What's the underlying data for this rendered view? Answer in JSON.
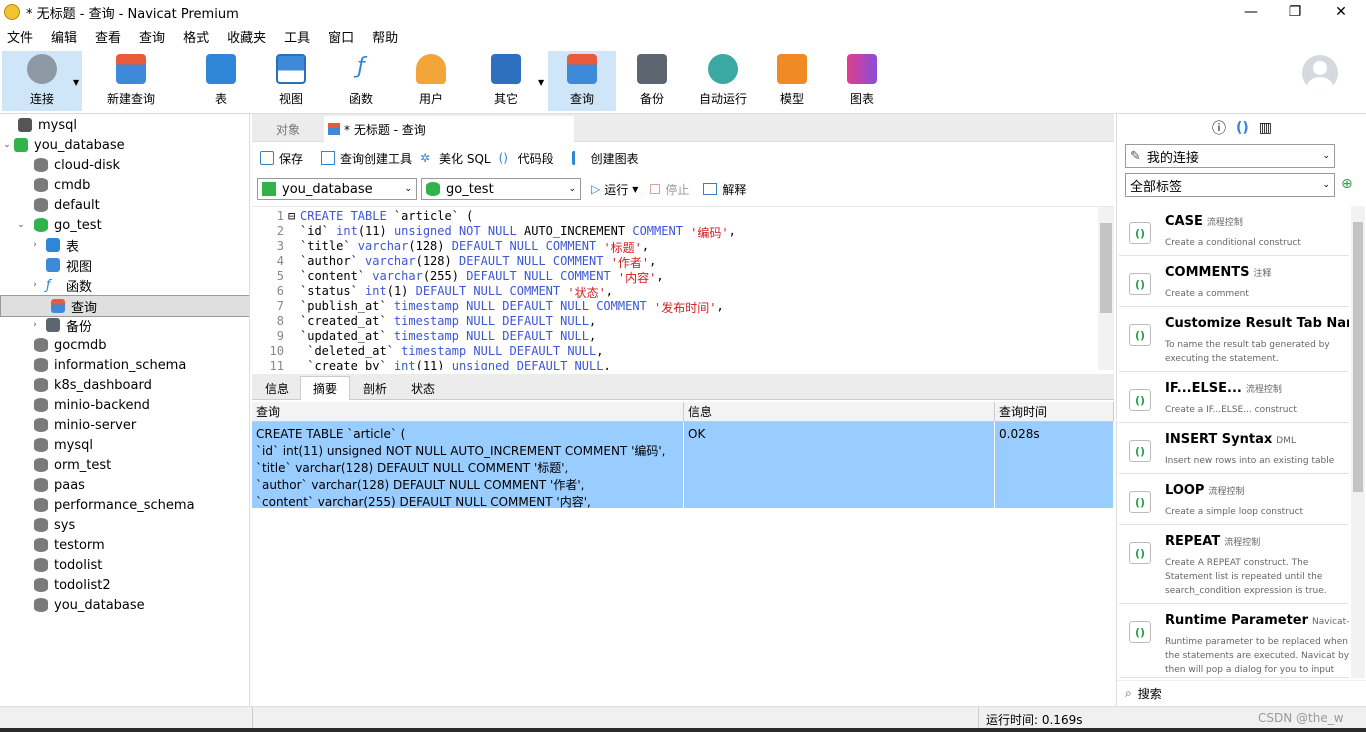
{
  "window": {
    "title": "* 无标题 - 查询 - Navicat Premium",
    "min": "—",
    "max": "❐",
    "close": "✕"
  },
  "menu": [
    "文件",
    "编辑",
    "查看",
    "查询",
    "格式",
    "收藏夹",
    "工具",
    "窗口",
    "帮助"
  ],
  "toolbar": {
    "connect": "连接",
    "new_query": "新建查询",
    "table": "表",
    "view": "视图",
    "function": "函数",
    "user": "用户",
    "other": "其它",
    "query": "查询",
    "backup": "备份",
    "auto_run": "自动运行",
    "model": "模型",
    "chart": "图表"
  },
  "tree": {
    "items": [
      "mysql",
      "you_database",
      "cloud-disk",
      "cmdb",
      "default",
      "go_test",
      "表",
      "视图",
      "函数",
      "查询",
      "备份",
      "gocmdb",
      "information_schema",
      "k8s_dashboard",
      "minio-backend",
      "minio-server",
      "mysql",
      "orm_test",
      "paas",
      "performance_schema",
      "sys",
      "testorm",
      "todolist",
      "todolist2",
      "you_database"
    ]
  },
  "tabs": {
    "objects": "对象",
    "query_tab": "* 无标题 - 查询"
  },
  "query_toolbar": {
    "save": "保存",
    "builder": "查询创建工具",
    "beautify": "美化 SQL",
    "snippet": "代码段",
    "create_chart": "创建图表"
  },
  "selectors": {
    "connection": "you_database",
    "database": "go_test",
    "run": "运行",
    "stop": "停止",
    "explain": "解释"
  },
  "editor": {
    "lines": [
      {
        "n": "1",
        "parts": [
          [
            "kw",
            "CREATE TABLE "
          ],
          [
            "code",
            "`article` ("
          ]
        ]
      },
      {
        "n": "2",
        "parts": [
          [
            "code",
            "`id` "
          ],
          [
            "kw",
            "int"
          ],
          [
            "code",
            "(11) "
          ],
          [
            "kw",
            "unsigned NOT NULL "
          ],
          [
            "code",
            "AUTO_INCREMENT "
          ],
          [
            "kw",
            "COMMENT "
          ],
          [
            "str",
            "'编码'"
          ],
          [
            "code",
            ","
          ]
        ]
      },
      {
        "n": "3",
        "parts": [
          [
            "code",
            "`title` "
          ],
          [
            "kw",
            "varchar"
          ],
          [
            "code",
            "(128) "
          ],
          [
            "kw",
            "DEFAULT NULL COMMENT "
          ],
          [
            "str",
            "'标题'"
          ],
          [
            "code",
            ","
          ]
        ]
      },
      {
        "n": "4",
        "parts": [
          [
            "code",
            "`author` "
          ],
          [
            "kw",
            "varchar"
          ],
          [
            "code",
            "(128) "
          ],
          [
            "kw",
            "DEFAULT NULL COMMENT "
          ],
          [
            "str",
            "'作者'"
          ],
          [
            "code",
            ","
          ]
        ]
      },
      {
        "n": "5",
        "parts": [
          [
            "code",
            "`content` "
          ],
          [
            "kw",
            "varchar"
          ],
          [
            "code",
            "(255) "
          ],
          [
            "kw",
            "DEFAULT NULL COMMENT "
          ],
          [
            "str",
            "'内容'"
          ],
          [
            "code",
            ","
          ]
        ]
      },
      {
        "n": "6",
        "parts": [
          [
            "code",
            "`status` "
          ],
          [
            "kw",
            "int"
          ],
          [
            "code",
            "(1) "
          ],
          [
            "kw",
            "DEFAULT NULL COMMENT "
          ],
          [
            "str",
            "'状态'"
          ],
          [
            "code",
            ","
          ]
        ]
      },
      {
        "n": "7",
        "parts": [
          [
            "code",
            "`publish_at` "
          ],
          [
            "kw",
            "timestamp NULL DEFAULT NULL COMMENT "
          ],
          [
            "str",
            "'发布时间'"
          ],
          [
            "code",
            ","
          ]
        ]
      },
      {
        "n": "8",
        "parts": [
          [
            "code",
            "`created_at` "
          ],
          [
            "kw",
            "timestamp NULL DEFAULT NULL"
          ],
          [
            "code",
            ","
          ]
        ]
      },
      {
        "n": "9",
        "parts": [
          [
            "code",
            "`updated_at` "
          ],
          [
            "kw",
            "timestamp NULL DEFAULT NULL"
          ],
          [
            "code",
            ","
          ]
        ]
      },
      {
        "n": "10",
        "parts": [
          [
            "code",
            " `deleted_at` "
          ],
          [
            "kw",
            "timestamp NULL DEFAULT NULL"
          ],
          [
            "code",
            ","
          ]
        ]
      },
      {
        "n": "11",
        "parts": [
          [
            "code",
            " `create_by` "
          ],
          [
            "kw",
            "int"
          ],
          [
            "code",
            "(11) "
          ],
          [
            "kw",
            "unsigned DEFAULT NULL"
          ],
          [
            "code",
            ","
          ]
        ]
      }
    ]
  },
  "result_tabs": [
    "信息",
    "摘要",
    "剖析",
    "状态"
  ],
  "result": {
    "headers": {
      "query": "查询",
      "info": "信息",
      "time": "查询时间"
    },
    "row": {
      "query": "CREATE TABLE `article` (\n`id` int(11) unsigned NOT NULL AUTO_INCREMENT COMMENT '编码',\n`title` varchar(128) DEFAULT NULL COMMENT '标题',\n`author` varchar(128) DEFAULT NULL COMMENT '作者',\n`content` varchar(255) DEFAULT NULL COMMENT '内容',",
      "info": "OK",
      "time": "0.028s"
    }
  },
  "right_panel": {
    "connection_select": "我的连接",
    "tag_select": "全部标签",
    "snippets": [
      {
        "name": "CASE",
        "tag": "流程控制",
        "desc": "Create a conditional construct"
      },
      {
        "name": "COMMENTS",
        "tag": "注释",
        "desc": "Create a comment"
      },
      {
        "name": "Customize Result Tab Name",
        "tag": "Na",
        "desc": "To name the result tab generated by executing the statement."
      },
      {
        "name": "IF...ELSE...",
        "tag": "流程控制",
        "desc": "Create a IF...ELSE... construct"
      },
      {
        "name": "INSERT Syntax",
        "tag": "DML",
        "desc": "Insert new rows into an existing table"
      },
      {
        "name": "LOOP",
        "tag": "流程控制",
        "desc": "Create a simple loop construct"
      },
      {
        "name": "REPEAT",
        "tag": "流程控制",
        "desc": "Create A REPEAT construct. The Statement list is repeated until the search_condition expression is true."
      },
      {
        "name": "Runtime Parameter",
        "tag": "Navicat-only S",
        "desc": "Runtime parameter to be replaced when the statements are executed. Navicat by then will pop a dialog for you to input"
      }
    ],
    "search": "搜索"
  },
  "status": {
    "runtime": "运行时间: 0.169s",
    "watermark": "CSDN @the_w"
  }
}
